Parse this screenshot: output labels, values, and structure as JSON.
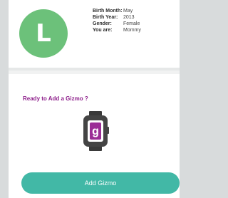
{
  "profile": {
    "avatar_initial": "L",
    "details": [
      {
        "label": "Birth Month:",
        "value": "May"
      },
      {
        "label": "Birth Year:",
        "value": "2013"
      },
      {
        "label": "Gender:",
        "value": "Female"
      },
      {
        "label": "You are:",
        "value": "Mommy"
      }
    ]
  },
  "gizmo": {
    "prompt": "Ready to Add a Gizmo ?",
    "device_icon": "gizmo-watch-icon",
    "device_glyph": "g",
    "button_label": "Add Gizmo"
  },
  "colors": {
    "avatar": "#6cc17a",
    "accent_purple": "#8e1f8b",
    "button_teal": "#42b8a6"
  }
}
